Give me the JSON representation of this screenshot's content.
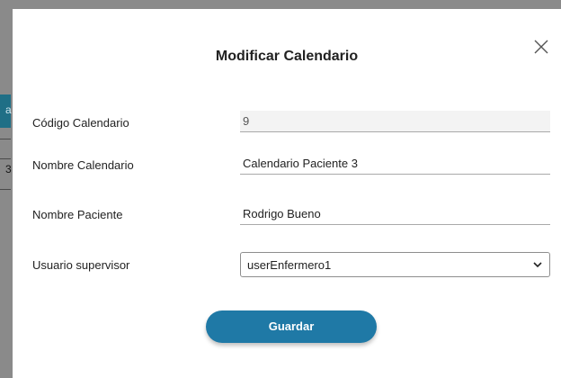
{
  "background": {
    "teal_char": "a",
    "cell_chars": [
      "",
      "3",
      ""
    ]
  },
  "modal": {
    "title": "Modificar Calendario",
    "close_icon": "close-icon",
    "fields": {
      "codigo": {
        "label": "Código Calendario",
        "value": "9"
      },
      "nombre_calendario": {
        "label": "Nombre Calendario",
        "value": "Calendario Paciente 3"
      },
      "nombre_paciente": {
        "label": "Nombre Paciente",
        "value": "Rodrigo Bueno"
      },
      "usuario_supervisor": {
        "label": "Usuario supervisor",
        "selected": "userEnfermero1"
      }
    },
    "save_label": "Guardar"
  },
  "colors": {
    "accent": "#1f79a6",
    "overlay": "#8a8a8a",
    "bg_teal": "#1f6f86"
  }
}
